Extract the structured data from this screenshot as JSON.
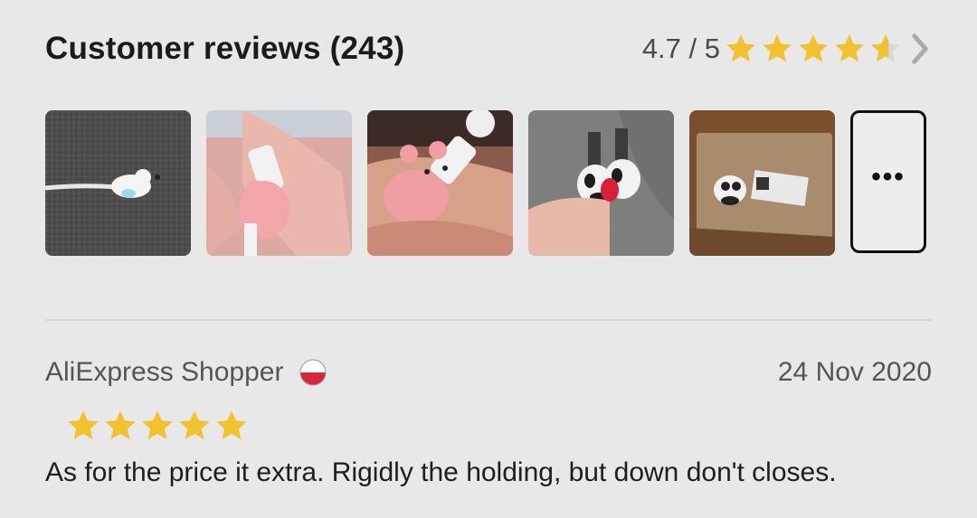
{
  "header": {
    "title": "Customer reviews (243)",
    "rating_text": "4.7 / 5",
    "rating_value": 4.7,
    "rating_max": 5,
    "star_color": "#f2c12e",
    "star_empty_color": "#d9d9d9"
  },
  "thumbnails": {
    "images": [
      {
        "icon": "photo-cable-protector-white"
      },
      {
        "icon": "photo-pink-pig-cable-protector-in-hand"
      },
      {
        "icon": "photo-pink-pig-cable-protector-closeup"
      },
      {
        "icon": "photo-panda-cable-protectors"
      },
      {
        "icon": "photo-package-with-panda"
      }
    ],
    "more_label": "•••"
  },
  "review": {
    "reviewer": "AliExpress Shopper",
    "country_flag": "poland-flag-icon",
    "date": "24 Nov 2020",
    "stars": 5,
    "text": "As for the price it extra. Rigidly the holding, but down don't closes."
  }
}
